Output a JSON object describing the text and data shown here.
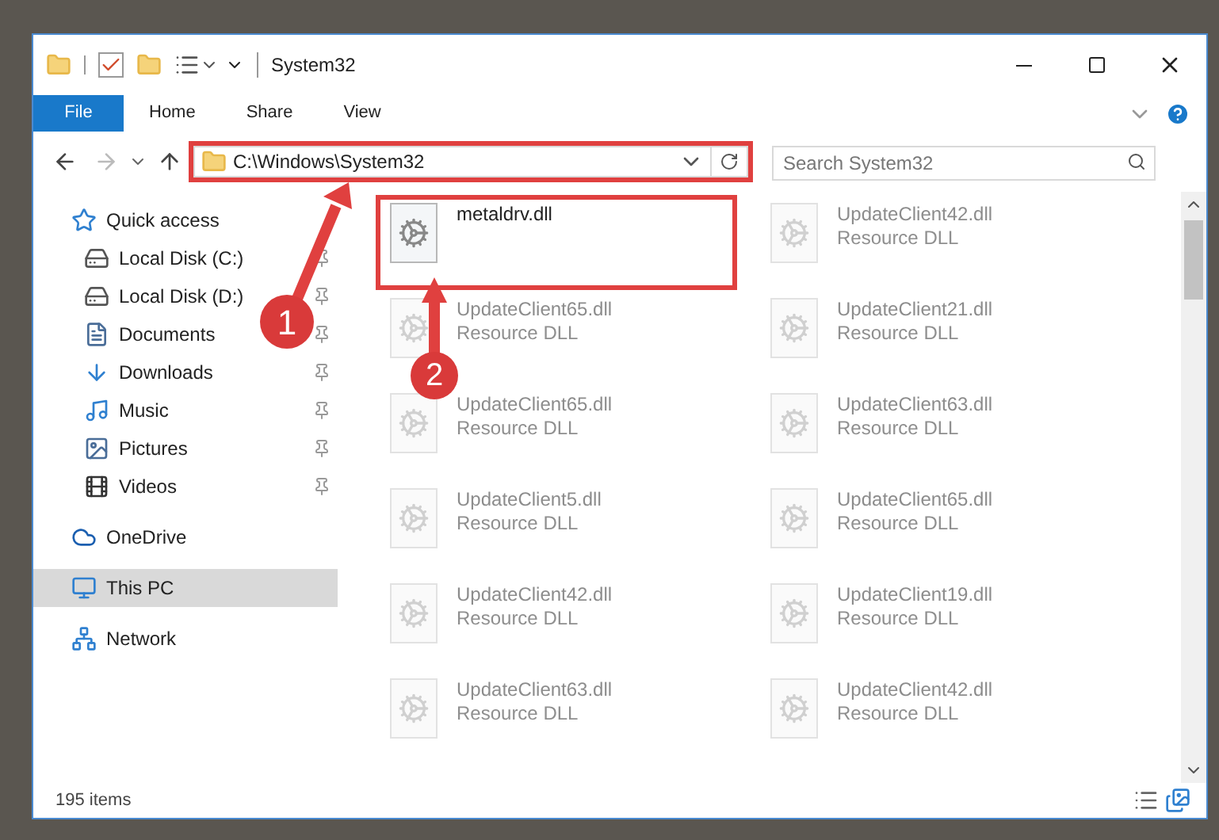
{
  "window": {
    "title": "System32"
  },
  "ribbon_tabs": [
    {
      "label": "File",
      "kind": "menu"
    },
    {
      "label": "Home",
      "kind": "tab"
    },
    {
      "label": "Share",
      "kind": "tab"
    },
    {
      "label": "View",
      "kind": "tab"
    }
  ],
  "address_bar": {
    "value": "C:\\Windows\\System32",
    "highlighted": true
  },
  "search": {
    "placeholder": "Search System32"
  },
  "sidebar": {
    "items": [
      {
        "label": "Quick access",
        "selected": false,
        "children": [
          {
            "label": "Local Disk (C:)",
            "pinned": true
          },
          {
            "label": "Local Disk (D:)",
            "pinned": true
          },
          {
            "label": "Documents",
            "pinned": true
          },
          {
            "label": "Downloads",
            "pinned": true
          },
          {
            "label": "Music",
            "pinned": true
          },
          {
            "label": "Pictures",
            "pinned": true
          },
          {
            "label": "Videos",
            "pinned": true
          }
        ]
      },
      {
        "label": "OneDrive",
        "selected": false
      },
      {
        "label": "This PC",
        "selected": true
      },
      {
        "label": "Network",
        "selected": false
      }
    ]
  },
  "files": [
    {
      "name": "metaldrv.dll",
      "dimmed": false,
      "highlighted": true
    },
    {
      "name": "UpdateClient42.dll",
      "type": "Resource DLL",
      "dimmed": true,
      "highlighted": false
    },
    {
      "name": "UpdateClient65.dll",
      "type": "Resource DLL",
      "dimmed": true,
      "highlighted": false
    },
    {
      "name": "UpdateClient21.dll",
      "type": "Resource DLL",
      "dimmed": true,
      "highlighted": false
    },
    {
      "name": "UpdateClient65.dll",
      "type": "Resource DLL",
      "dimmed": true,
      "highlighted": false
    },
    {
      "name": "UpdateClient63.dll",
      "type": "Resource DLL",
      "dimmed": true,
      "highlighted": false
    },
    {
      "name": "UpdateClient5.dll",
      "type": "Resource DLL",
      "dimmed": true,
      "highlighted": false
    },
    {
      "name": "UpdateClient65.dll",
      "type": "Resource DLL",
      "dimmed": true,
      "highlighted": false
    },
    {
      "name": "UpdateClient42.dll",
      "type": "Resource DLL",
      "dimmed": true,
      "highlighted": false
    },
    {
      "name": "UpdateClient19.dll",
      "type": "Resource DLL",
      "dimmed": true,
      "highlighted": false
    },
    {
      "name": "UpdateClient63.dll",
      "type": "Resource DLL",
      "dimmed": true,
      "highlighted": false
    },
    {
      "name": "UpdateClient42.dll",
      "type": "Resource DLL",
      "dimmed": true,
      "highlighted": false
    }
  ],
  "status_bar": {
    "count": "195 items"
  },
  "annotations": [
    {
      "label": "1"
    },
    {
      "label": "2"
    }
  ]
}
